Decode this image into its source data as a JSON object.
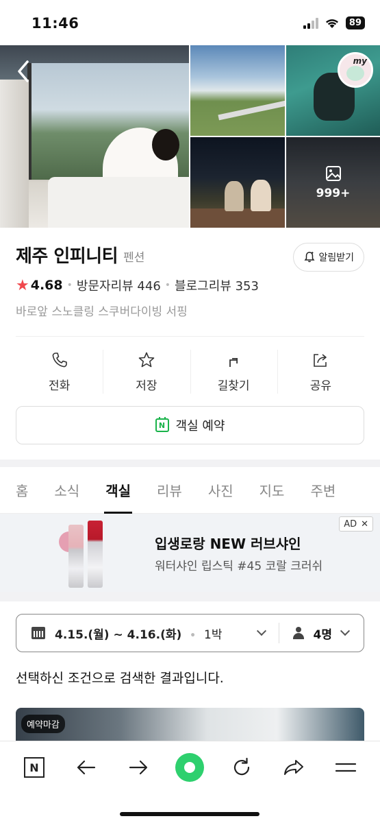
{
  "status_bar": {
    "time": "11:46",
    "battery": "89"
  },
  "gallery": {
    "more_count": "999+",
    "badge_text": "my"
  },
  "place": {
    "name": "제주 인피니티",
    "category": "펜션",
    "alarm_label": "알림받기",
    "rating": "4.68",
    "visitor_reviews": "방문자리뷰 446",
    "blog_reviews": "블로그리뷰 353",
    "tags": "바로앞 스노클링 스쿠버다이빙 서핑"
  },
  "actions": [
    {
      "label": "전화",
      "icon": "phone-icon"
    },
    {
      "label": "저장",
      "icon": "star-icon"
    },
    {
      "label": "길찾기",
      "icon": "directions-icon"
    },
    {
      "label": "공유",
      "icon": "share-icon"
    }
  ],
  "reserve_label": "객실 예약",
  "tabs": [
    {
      "label": "홈"
    },
    {
      "label": "소식"
    },
    {
      "label": "객실",
      "active": true
    },
    {
      "label": "리뷰"
    },
    {
      "label": "사진"
    },
    {
      "label": "지도"
    },
    {
      "label": "주변"
    }
  ],
  "ad": {
    "headline": "입생로랑 NEW 러브샤인",
    "subline": "워터샤인 립스틱 #45 코랄 크러쉬",
    "tag": "AD",
    "close": "✕"
  },
  "booking": {
    "dates": "4.15.(월) ~ 4.16.(화)",
    "nights": "1박",
    "guests": "4명"
  },
  "result_text": "선택하신 조건으로 검색한 결과입니다.",
  "room": {
    "badge": "예약마감"
  },
  "bottom_bar": {
    "n_label": "N"
  },
  "colors": {
    "accent_green": "#19b34a",
    "star_red": "#f0474c",
    "nav_green": "#2ed06e"
  }
}
